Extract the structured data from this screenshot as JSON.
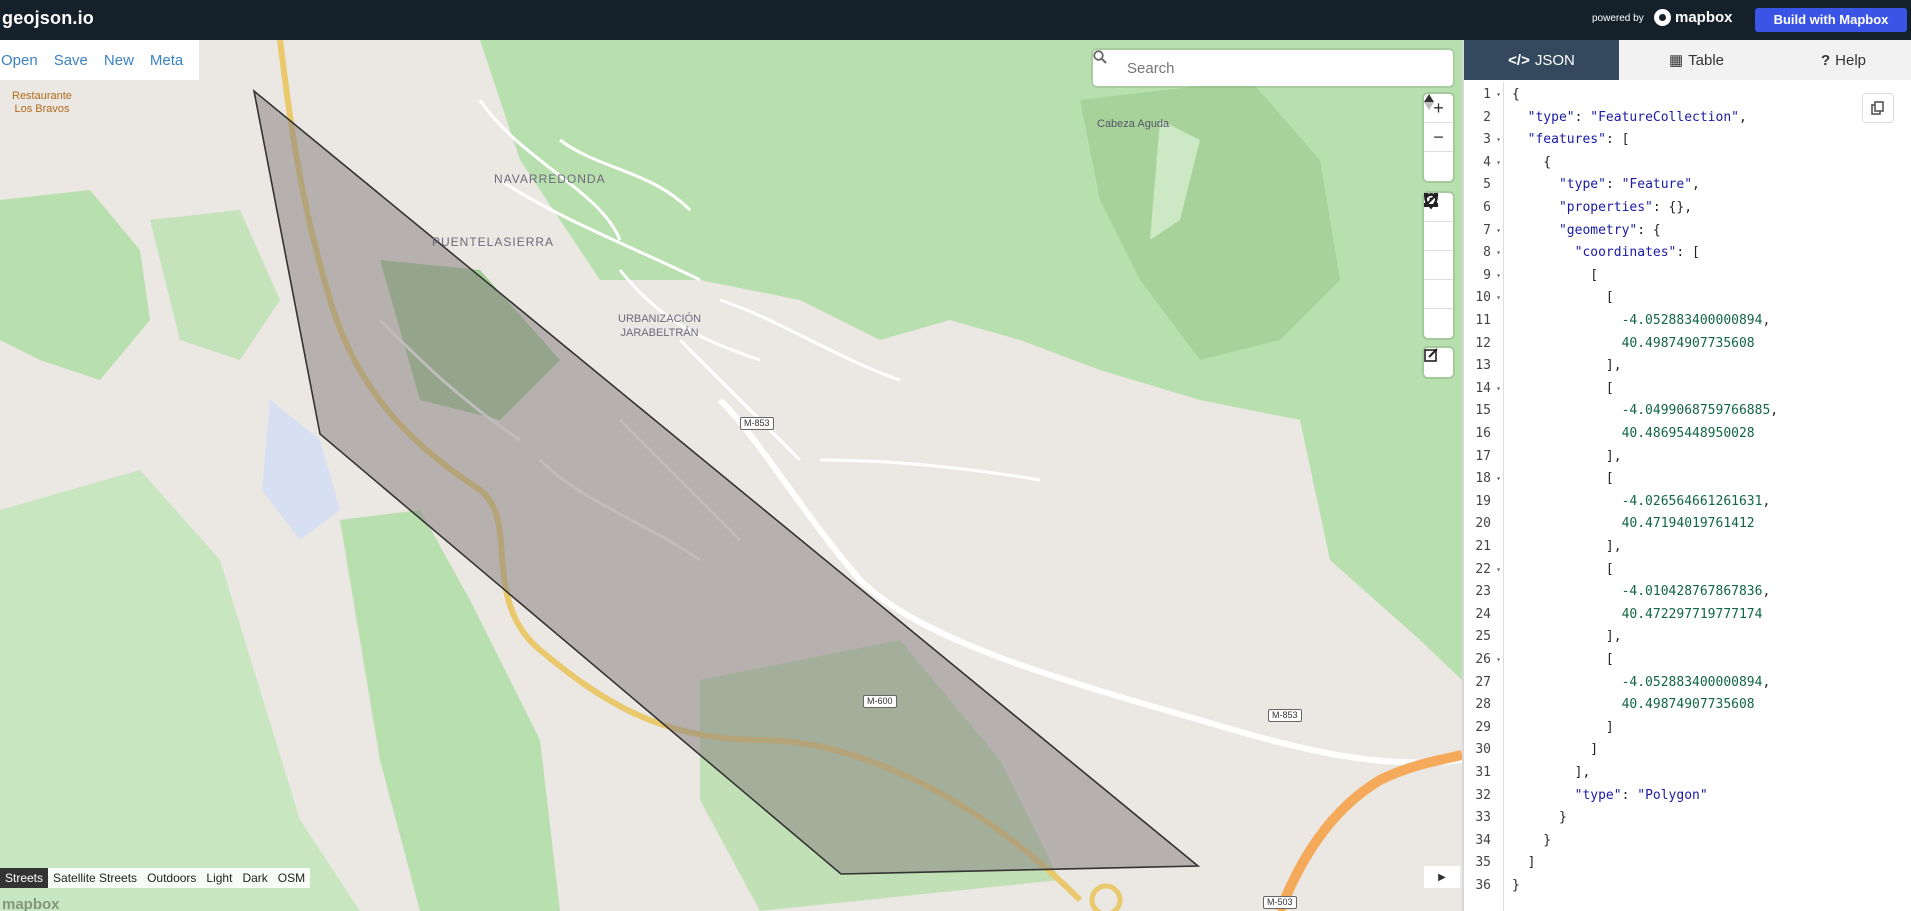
{
  "app": {
    "logo": "geojson.io",
    "powered_by": "powered by",
    "mapbox_label": "mapbox",
    "build_button": "Build with Mapbox"
  },
  "file_menu": {
    "items": [
      "Open",
      "Save",
      "New",
      "Meta"
    ]
  },
  "search": {
    "placeholder": "Search"
  },
  "map": {
    "labels": {
      "restaurant_line1": "Restaurante",
      "restaurant_line2": "Los Bravos",
      "navarredonda": "NAVARREDONDA",
      "puentelasierra": "PUENTELASIERRA",
      "urbanizacion_line1": "URBANIZACIÓN",
      "urbanizacion_line2": "JARABELTRÁN",
      "cabeza_aguda": "Cabeza Aguda",
      "road_m853_a": "M-853",
      "road_m853_b": "M-853",
      "road_m600": "M-600",
      "road_m503": "M-503"
    },
    "zoom_in": "+",
    "zoom_out": "−",
    "style_options": [
      "Streets",
      "Satellite Streets",
      "Outdoors",
      "Light",
      "Dark",
      "OSM"
    ],
    "active_style": "Streets",
    "watermark": "mapbox"
  },
  "panel": {
    "tabs": [
      {
        "label": "JSON",
        "icon": "code-icon",
        "active": true
      },
      {
        "label": "Table",
        "icon": "table-icon",
        "active": false
      },
      {
        "label": "Help",
        "icon": "question-icon",
        "active": false
      }
    ],
    "line_numbers": [
      "1",
      "2",
      "3",
      "4",
      "5",
      "6",
      "7",
      "8",
      "9",
      "10",
      "11",
      "12",
      "13",
      "14",
      "15",
      "16",
      "17",
      "18",
      "19",
      "20",
      "21",
      "22",
      "23",
      "24",
      "25",
      "26",
      "27",
      "28",
      "29",
      "30",
      "31",
      "32",
      "33",
      "34",
      "35",
      "36"
    ],
    "code_lines": [
      "{",
      "  \"type\": \"FeatureCollection\",",
      "  \"features\": [",
      "    {",
      "      \"type\": \"Feature\",",
      "      \"properties\": {},",
      "      \"geometry\": {",
      "        \"coordinates\": [",
      "          [",
      "            [",
      "              -4.052883400000894,",
      "              40.49874907735608",
      "            ],",
      "            [",
      "              -4.0499068759766885,",
      "              40.48695448950028",
      "            ],",
      "            [",
      "              -4.026564661261631,",
      "              40.47194019761412",
      "            ],",
      "            [",
      "              -4.010428767867836,",
      "              40.472297719777174",
      "            ],",
      "            [",
      "              -4.052883400000894,",
      "              40.49874907735608",
      "            ]",
      "          ]",
      "        ],",
      "        \"type\": \"Polygon\"",
      "      }",
      "    }",
      "  ]",
      "}"
    ]
  },
  "colors": {
    "topbar": "#15212a",
    "accent_button": "#3a55e6",
    "link": "#3b82c4",
    "polygon_fill": "#8a8585",
    "json_tab_active": "#34495e"
  }
}
